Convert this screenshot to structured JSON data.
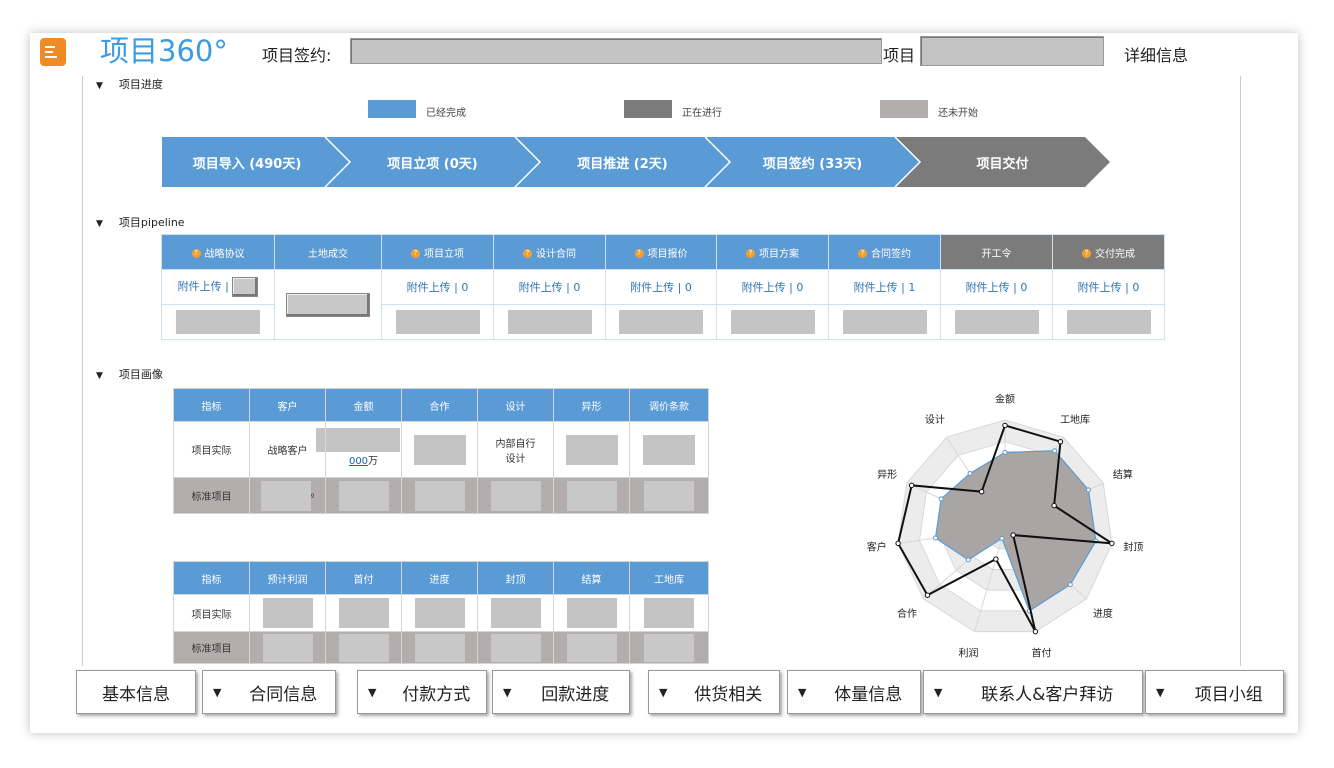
{
  "header": {
    "title": "项目360°",
    "sign_label": "项目签约:",
    "project_label": "项目",
    "detail_label": "详细信息"
  },
  "progress": {
    "section_title": "项目进度",
    "legend": [
      {
        "label": "已经完成",
        "color": "#5b9bd5"
      },
      {
        "label": "正在进行",
        "color": "#7b7b7b"
      },
      {
        "label": "还未开始",
        "color": "#b3aeae"
      }
    ],
    "stages": [
      {
        "label": "项目导入 (490天)",
        "status": "done"
      },
      {
        "label": "项目立项 (0天)",
        "status": "done"
      },
      {
        "label": "项目推进 (2天)",
        "status": "done"
      },
      {
        "label": "项目签约 (33天)",
        "status": "done"
      },
      {
        "label": "项目交付",
        "status": "in-progress"
      }
    ]
  },
  "pipeline": {
    "section_title": "项目pipeline",
    "columns": [
      {
        "label": "战略协议",
        "coin": "?",
        "upload": "附件上传 |"
      },
      {
        "label": "土地成交",
        "coin": "",
        "upload": ""
      },
      {
        "label": "项目立项",
        "coin": "?",
        "upload": "附件上传 | 0"
      },
      {
        "label": "设计合同",
        "coin": "?",
        "upload": "附件上传 | 0"
      },
      {
        "label": "项目报价",
        "coin": "?",
        "upload": "附件上传 | 0"
      },
      {
        "label": "项目方案",
        "coin": "?",
        "upload": "附件上传 | 0"
      },
      {
        "label": "合同签约",
        "coin": "?",
        "upload": "附件上传 | 1"
      },
      {
        "label": "开工令",
        "coin": "",
        "upload": "附件上传 | 0"
      },
      {
        "label": "交付完成",
        "coin": "?",
        "upload": "附件上传 | 0"
      }
    ]
  },
  "portrait": {
    "section_title": "项目画像",
    "table1": {
      "headers": [
        "指标",
        "客户",
        "金额",
        "合作",
        "设计",
        "异形",
        "调价条款"
      ],
      "actual_label": "项目实际",
      "customer": "战略客户",
      "amount": "000",
      "amount_unit": "万",
      "design_l1": "内部自行",
      "design_l2": "设计",
      "std_label": "标准项目",
      "std_customer_tail": "º"
    },
    "table2": {
      "headers": [
        "指标",
        "预计利润",
        "首付",
        "进度",
        "封顶",
        "结算",
        "工地库"
      ],
      "actual_label": "项目实际",
      "std_label": "标准项目"
    }
  },
  "radar": {
    "axes": [
      "金额",
      "工地库",
      "结算",
      "封顶",
      "进度",
      "首付",
      "利润",
      "合作",
      "客户",
      "异形",
      "设计"
    ],
    "actual": [
      0.95,
      0.95,
      0.5,
      1.0,
      0.1,
      1.0,
      0.3,
      0.95,
      1.0,
      0.95,
      0.4
    ],
    "standard": [
      0.7,
      0.85,
      0.85,
      0.85,
      0.8,
      0.8,
      0.1,
      0.45,
      0.65,
      0.65,
      0.6
    ]
  },
  "tabs": [
    {
      "label": "基本信息",
      "arrow": ""
    },
    {
      "label": "合同信息",
      "arrow": "▼"
    },
    {
      "label": "付款方式",
      "arrow": "▼"
    },
    {
      "label": "回款进度",
      "arrow": "▼"
    },
    {
      "label": "供货相关",
      "arrow": "▼"
    },
    {
      "label": "体量信息",
      "arrow": "▼"
    },
    {
      "label": "联系人&客户拜访",
      "arrow": "▼"
    },
    {
      "label": "项目小组",
      "arrow": "▼"
    }
  ]
}
